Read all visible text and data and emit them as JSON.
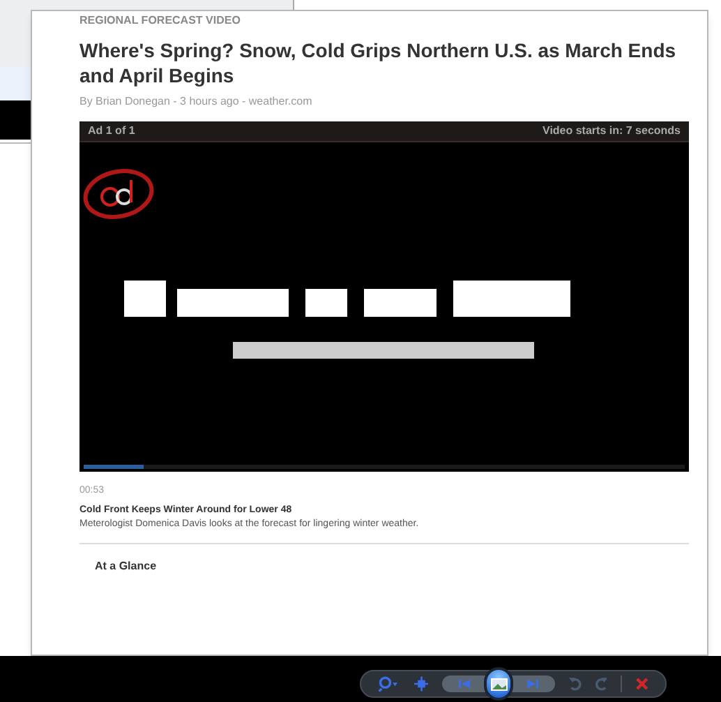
{
  "article": {
    "kicker": "REGIONAL FORECAST VIDEO",
    "title": "Where's Spring? Snow, Cold Grips Northern U.S. as March Ends and April Begins",
    "byline": "By Brian Donegan - 3 hours ago - weather.com"
  },
  "video": {
    "kind": "picture",
    "ad_label": "Ad 1 of 1",
    "countdown": "Video starts in: 7 seconds",
    "progress": {
      "level": 0.1
    }
  },
  "clip": {
    "duration": "00:53",
    "title": "Cold Front Keeps Winter Around for Lower 48",
    "description": "Meterologist Domenica Davis looks at the forecast for lingering winter weather."
  },
  "section": {
    "heading": "At a Glance"
  }
}
